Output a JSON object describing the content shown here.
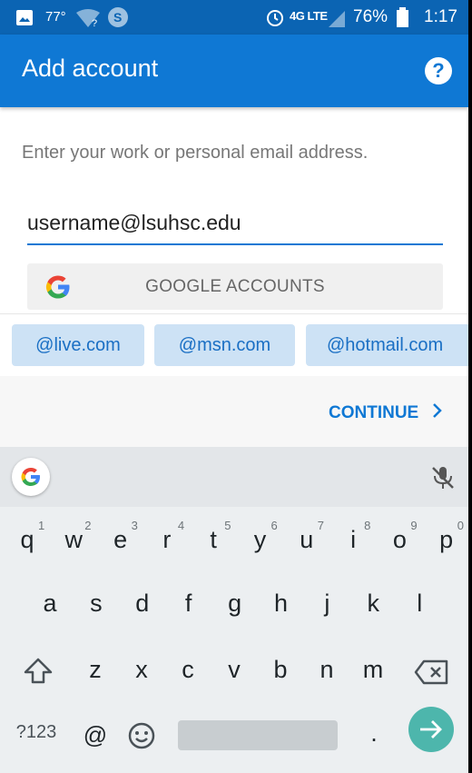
{
  "status_bar": {
    "temperature": "77°",
    "battery": "76%",
    "time": "1:17",
    "network": "4G LTE",
    "icons": [
      "gallery-icon",
      "wifi-unknown-icon",
      "shazam-icon",
      "alarm-icon",
      "signal-icon",
      "battery-icon"
    ]
  },
  "app_bar": {
    "title": "Add account",
    "help_icon": "?"
  },
  "form": {
    "prompt": "Enter your work or personal email address.",
    "email_value": "username@lsuhsc.edu",
    "google_button": "GOOGLE ACCOUNTS"
  },
  "domains": [
    "@live.com",
    "@msn.com",
    "@hotmail.com"
  ],
  "continue_label": "CONTINUE",
  "colors": {
    "status_bar": "#0b64b3",
    "app_bar": "#0f78d4",
    "chip": "#cde2f5",
    "accent": "#1a6fc4",
    "enter_key": "#4db6ac"
  },
  "keyboard": {
    "row1": [
      "q",
      "w",
      "e",
      "r",
      "t",
      "y",
      "u",
      "i",
      "o",
      "p"
    ],
    "row1_hints": [
      "1",
      "2",
      "3",
      "4",
      "5",
      "6",
      "7",
      "8",
      "9",
      "0"
    ],
    "row2": [
      "a",
      "s",
      "d",
      "f",
      "g",
      "h",
      "j",
      "k",
      "l"
    ],
    "row3": [
      "z",
      "x",
      "c",
      "v",
      "b",
      "n",
      "m"
    ],
    "symbols_key": "?123",
    "at_key": "@",
    "period_key": "."
  }
}
